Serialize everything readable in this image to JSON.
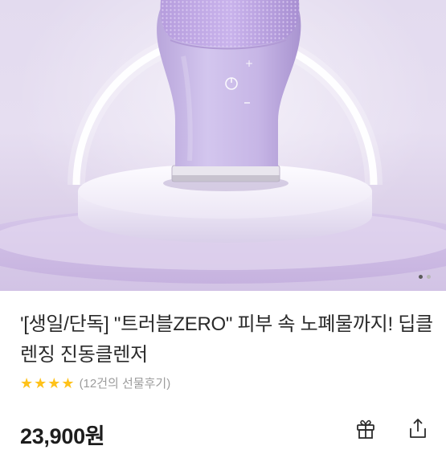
{
  "product": {
    "image": {
      "alt": "",
      "carousel_total": 2,
      "carousel_active": 1
    },
    "title": "'[생일/단독] \"트러블ZERO\" 피부 속 노폐물까지! 딥클렌징 진동클렌저",
    "rating_stars": 4,
    "review_text": "(12건의 선물후기)",
    "price": "23,900원"
  },
  "actions": {
    "gift_icon": "gift-icon",
    "share_icon": "share-icon"
  },
  "colors": {
    "star": "#ffc21a",
    "device": "#c8b8e6",
    "background": "#e3dbef"
  }
}
